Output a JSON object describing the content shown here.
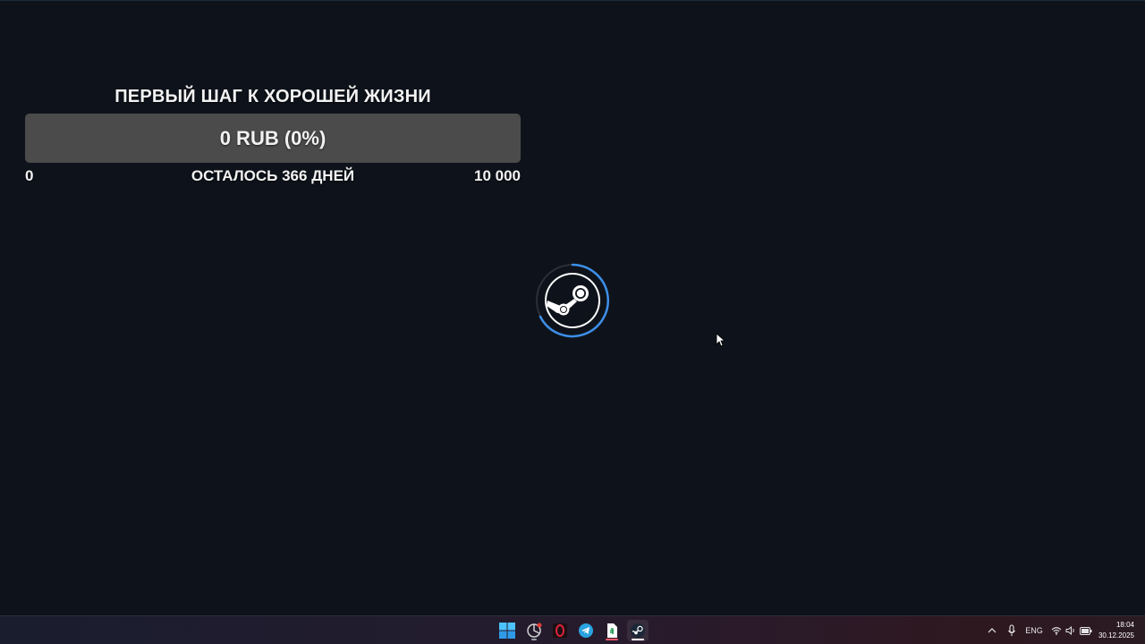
{
  "goal": {
    "title": "ПЕРВЫЙ ШАГ К ХОРОШЕЙ ЖИЗНИ",
    "progress_text": "0 RUB (0%)",
    "progress_fraction": 0,
    "min_label": "0",
    "remaining_label": "ОСТАЛОСЬ 366 ДНЕЙ",
    "max_label": "10 000",
    "fill_color": "#7ac943",
    "bar_color": "#4b4b4b"
  },
  "loader": {
    "icon": "steam-logo-icon",
    "ring_color": "#3d8fe8"
  },
  "taskbar": {
    "apps": [
      {
        "name": "start-button",
        "icon": "windows-logo-icon"
      },
      {
        "name": "taskbar-app-chrome-like",
        "icon": "app-circle-icon",
        "badge": true
      },
      {
        "name": "taskbar-app-opera",
        "icon": "opera-icon"
      },
      {
        "name": "taskbar-app-telegram",
        "icon": "telegram-icon"
      },
      {
        "name": "taskbar-app-notepad",
        "icon": "document-icon"
      },
      {
        "name": "taskbar-app-steam",
        "icon": "steam-icon",
        "active": true
      }
    ],
    "tray": {
      "language": "ENG",
      "time": "18:04",
      "date": "30.12.2025"
    }
  }
}
